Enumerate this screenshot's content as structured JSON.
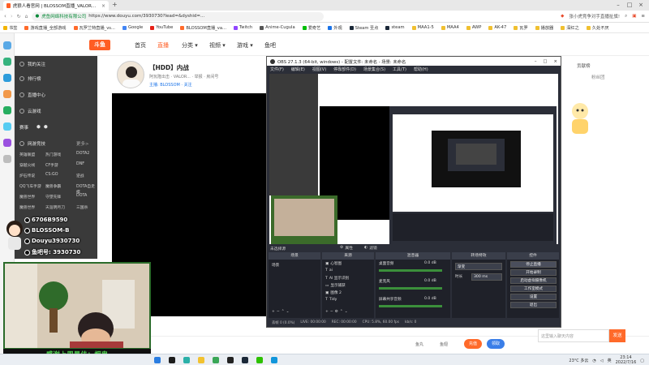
{
  "browser": {
    "tab_title": "虎狼人看官网 | BLOSSOM直播_VALORANT直播 - 斗鱼",
    "address_site": "虎鱼网络科技有限公司",
    "address_url": "https://www.douyu.com/3930730?lead=&dyshid=...",
    "right_hint": "张小虎竞争对手直播扯旗!",
    "bookmarks": [
      "书签",
      "游戏直播_全部游戏",
      "瓦罗兰特直播_vs...",
      "Google",
      "YouTube",
      "BLOSSOM直播_va...",
      "Twitch",
      "Anime-Cugula",
      "爱奇艺",
      "外观",
      "Steam 圣点",
      "steam",
      "MAA1-5",
      "MAA4",
      "AWP",
      "AK-47",
      "瓦罗",
      "播放器",
      "深红之",
      "久处不厌"
    ]
  },
  "douyu": {
    "logo": "斗鱼",
    "nav": [
      "首页",
      "直播",
      "分类 ▾",
      "视频 ▾",
      "游戏 ▾",
      "鱼吧"
    ],
    "sidebar": {
      "items": [
        "我的关注",
        "排行榜",
        "直播中心",
        "云游戏"
      ],
      "sub_items": [
        "赛事",
        "赛事"
      ],
      "section": "网游竞技",
      "more": "更多>",
      "grid": [
        [
          "英雄联盟",
          "热门游戏",
          "DOTA2"
        ],
        [
          "穿越火线",
          "CF手游",
          "DNF"
        ],
        [
          "炉石传说",
          "CS:GO",
          "逆战"
        ],
        [
          "QQ飞车手游",
          "魔兽争霸",
          "DOTA自走棋"
        ],
        [
          "魔兽世界",
          "守望先锋",
          "DOTA"
        ],
        [
          "魔兽世界",
          "天涯明月刀",
          "三国杀"
        ]
      ]
    },
    "room": {
      "title": "【HDD】内战",
      "meta": "阿瓦隆出击 · VALOR... · 举报 · 房间号",
      "category": "主播: BLOSSOM · 关注"
    },
    "right": {
      "rank_label": "贡献榜",
      "tab_label": "粉丝团"
    },
    "chat_placeholder": "这里输入聊天内容",
    "send_label": "发送",
    "bottom_items": [
      "鱼丸",
      "鱼翅"
    ],
    "bottom_btn_a": "充值",
    "bottom_btn_b": "领取"
  },
  "social": {
    "rows": [
      {
        "icon": "weibo-icon",
        "text": "6706B9590"
      },
      {
        "icon": "bilibili-icon",
        "text": "BLOSSOM-B"
      },
      {
        "icon": "douyin-icon",
        "text": "Douyu3930730"
      },
      {
        "icon": "fans-group-icon",
        "text": "鱼吧号: 3930730"
      }
    ]
  },
  "caption": "感谢上周最佳：烟鬼",
  "obs": {
    "title": "OBS 27.1.3 (64-bit, windows) - 配置文件: 未命名 - 场景: 未命名",
    "menu": [
      "文件(F)",
      "编辑(E)",
      "视图(V)",
      "停靠部件(D)",
      "场景集合(S)",
      "工具(T)",
      "帮助(H)"
    ],
    "tip": "未选择源",
    "props_label": "属性",
    "filter_label": "滤镜",
    "panels": [
      "场景",
      "来源",
      "混音器",
      "转场特效",
      "控件"
    ],
    "scene_item": "场景",
    "sources": [
      "心智图",
      "ai",
      "AI 显示识别",
      "显示捕获",
      "图像 2",
      "Tidy"
    ],
    "mixer": [
      {
        "name": "桌面音频",
        "db": "0.0 dB"
      },
      {
        "name": "麦克风",
        "db": "0.0 dB"
      },
      {
        "name": "屏幕共享音频",
        "db": "0.0 dB"
      }
    ],
    "transition": "渐变",
    "duration_label": "时长",
    "duration_value": "300 ms",
    "controls": [
      "停止直播",
      "开始录制",
      "启动虚拟摄像机",
      "工作室模式",
      "设置",
      "退出"
    ],
    "status": [
      "丢帧 0 (0.0%)",
      "LIVE: 00:00:00",
      "REC: 00:00:00",
      "CPU: 5.8%, 60.00 fps",
      "kb/s: 0"
    ]
  },
  "taskbar": {
    "weather": "23°C 多云",
    "lang": "英",
    "time": "23:14",
    "date": "2022/7/16"
  }
}
